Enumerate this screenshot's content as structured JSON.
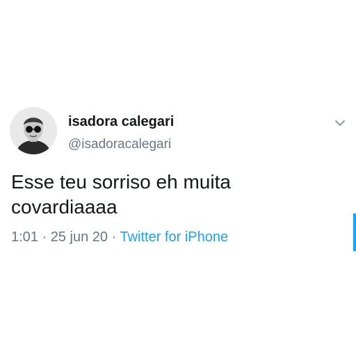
{
  "tweet": {
    "display_name": "isadora calegari",
    "handle": "@isadoracalegari",
    "text": "Esse teu sorriso eh muita covardiaaaa",
    "time": "1:01",
    "separator_1": "·",
    "date": "25 jun 20",
    "separator_2": "·",
    "source": "Twitter for iPhone"
  },
  "icons": {
    "avatar": "profile-photo",
    "more": "chevron-down-icon"
  },
  "colors": {
    "text_primary": "#14171a",
    "text_secondary": "#657786",
    "accent": "#1da1f2",
    "background": "#ffffff"
  }
}
